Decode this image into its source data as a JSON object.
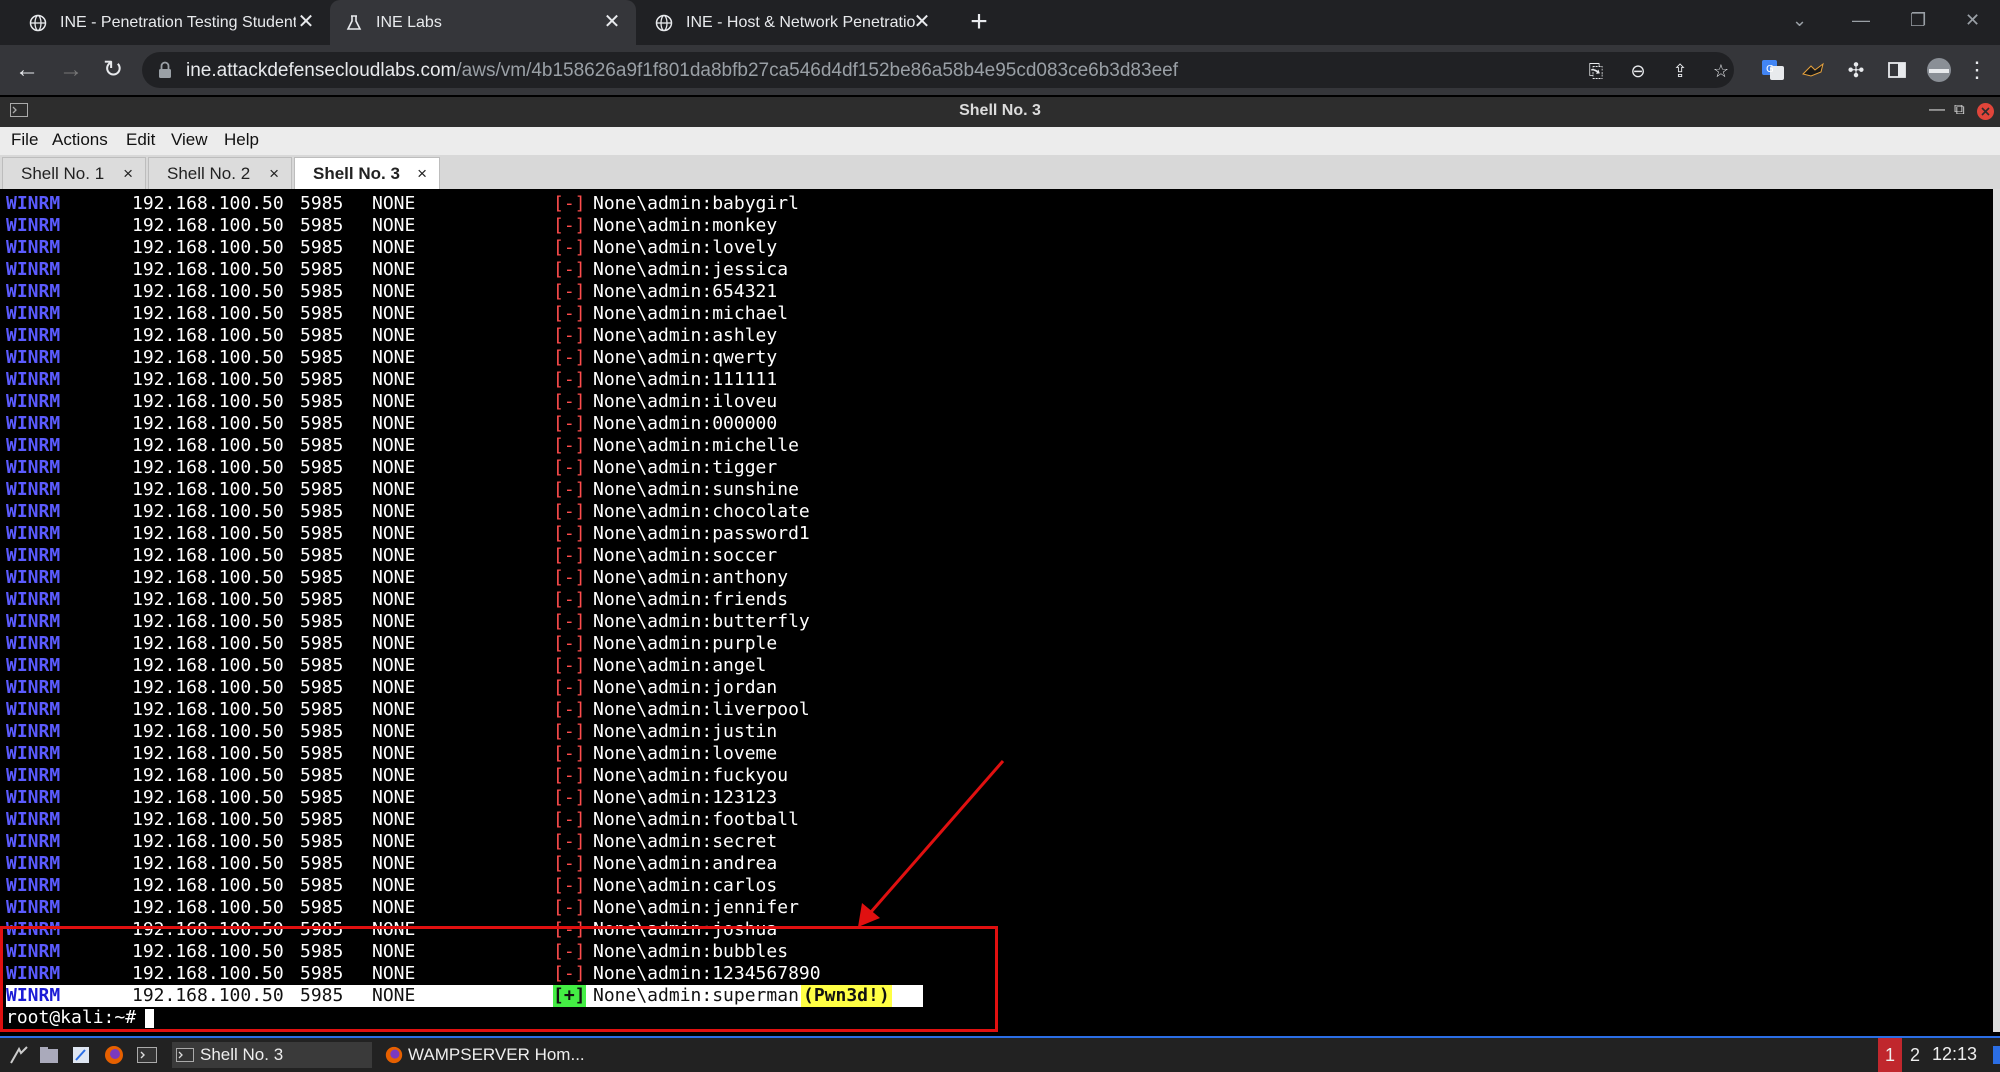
{
  "browser": {
    "tabs": [
      {
        "title": "INE - Penetration Testing Student",
        "close": "✕",
        "active": false
      },
      {
        "title": "INE Labs",
        "close": "✕",
        "active": true
      },
      {
        "title": "INE - Host & Network Penetratio",
        "close": "✕",
        "active": false
      }
    ],
    "new_tab": "+",
    "url_host": "ine.attackdefensecloudlabs.com",
    "url_path": "/aws/vm/4b158626a9f1f801da8bfb27ca546d4df152be86a58b4e95cd083ce6b3d83eef"
  },
  "terminal_window": {
    "title": "Shell No. 3",
    "menu": [
      "File",
      "Actions",
      "Edit",
      "View",
      "Help"
    ],
    "tabs": [
      {
        "label": "Shell No. 1",
        "close": "×",
        "active": false
      },
      {
        "label": "Shell No. 2",
        "close": "×",
        "active": false
      },
      {
        "label": "Shell No. 3",
        "close": "×",
        "active": true
      }
    ]
  },
  "output": {
    "protocol": "WINRM",
    "ip": "192.168.100.50",
    "port": "5985",
    "host": "NONE",
    "fail_marker": "[-]",
    "success_marker": "[+]",
    "pwned_label": "(Pwn3d!)",
    "rows": [
      "None\\admin:babygirl",
      "None\\admin:monkey",
      "None\\admin:lovely",
      "None\\admin:jessica",
      "None\\admin:654321",
      "None\\admin:michael",
      "None\\admin:ashley",
      "None\\admin:qwerty",
      "None\\admin:111111",
      "None\\admin:iloveu",
      "None\\admin:000000",
      "None\\admin:michelle",
      "None\\admin:tigger",
      "None\\admin:sunshine",
      "None\\admin:chocolate",
      "None\\admin:password1",
      "None\\admin:soccer",
      "None\\admin:anthony",
      "None\\admin:friends",
      "None\\admin:butterfly",
      "None\\admin:purple",
      "None\\admin:angel",
      "None\\admin:jordan",
      "None\\admin:liverpool",
      "None\\admin:justin",
      "None\\admin:loveme",
      "None\\admin:fuckyou",
      "None\\admin:123123",
      "None\\admin:football",
      "None\\admin:secret",
      "None\\admin:andrea",
      "None\\admin:carlos",
      "None\\admin:jennifer",
      "None\\admin:joshua",
      "None\\admin:bubbles",
      "None\\admin:1234567890"
    ],
    "success_row": "None\\admin:superman",
    "prompt": "root@kali:~#"
  },
  "taskbar": {
    "items": [
      "Shell No. 3",
      "WAMPSERVER Hom..."
    ],
    "workspaces": [
      "1",
      "2"
    ],
    "clock": "12:13"
  },
  "colors": {
    "accent": "#2b6ee5",
    "highlight": "#e01010",
    "fail": "#ff4d4d",
    "success": "#44ee44",
    "pwn": "#ffff44"
  }
}
